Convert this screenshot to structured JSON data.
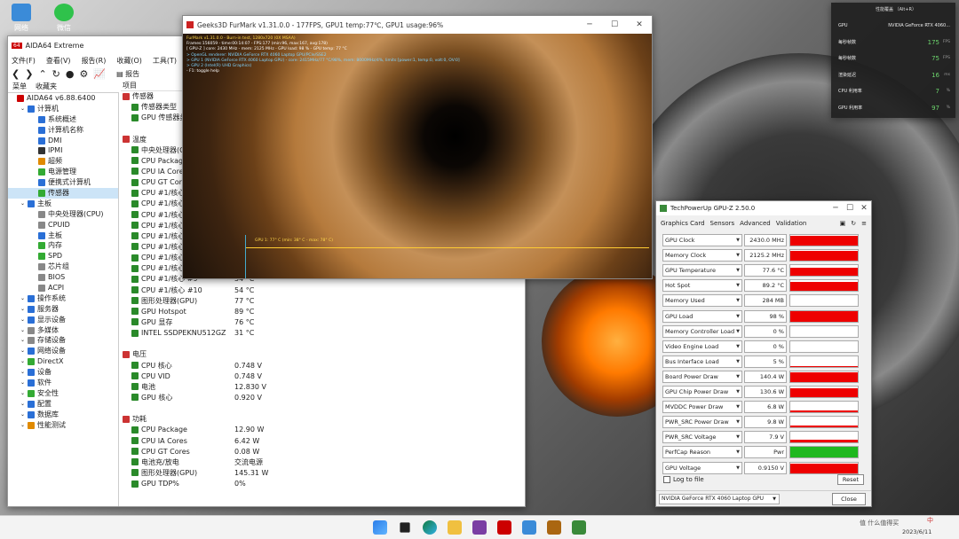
{
  "desktop": {
    "icons": [
      {
        "label": "网络"
      },
      {
        "label": "微信"
      }
    ]
  },
  "aida": {
    "title": "AIDA64 Extreme",
    "menu": [
      "文件(F)",
      "查看(V)",
      "报告(R)",
      "收藏(O)",
      "工具(T)",
      "帮助(H)"
    ],
    "toolbar_report": "报告",
    "tab_menu": "菜单",
    "tab_fav": "收藏夹",
    "tree": [
      {
        "label": "AIDA64 v6.88.6400",
        "depth": 0,
        "color": "#c00"
      },
      {
        "label": "计算机",
        "depth": 1,
        "color": "#2a6fd6"
      },
      {
        "label": "系统概述",
        "depth": 2,
        "color": "#2a6fd6"
      },
      {
        "label": "计算机名称",
        "depth": 2,
        "color": "#2a6fd6"
      },
      {
        "label": "DMI",
        "depth": 2,
        "color": "#2a6fd6"
      },
      {
        "label": "IPMI",
        "depth": 2,
        "color": "#333"
      },
      {
        "label": "超频",
        "depth": 2,
        "color": "#e08a00"
      },
      {
        "label": "电源管理",
        "depth": 2,
        "color": "#3a3"
      },
      {
        "label": "便携式计算机",
        "depth": 2,
        "color": "#2a6fd6"
      },
      {
        "label": "传感器",
        "depth": 2,
        "color": "#3a3",
        "selected": true
      },
      {
        "label": "主板",
        "depth": 1,
        "color": "#2a6fd6"
      },
      {
        "label": "中央处理器(CPU)",
        "depth": 2,
        "color": "#888"
      },
      {
        "label": "CPUID",
        "depth": 2,
        "color": "#888"
      },
      {
        "label": "主板",
        "depth": 2,
        "color": "#2a6fd6"
      },
      {
        "label": "内存",
        "depth": 2,
        "color": "#3a3"
      },
      {
        "label": "SPD",
        "depth": 2,
        "color": "#3a3"
      },
      {
        "label": "芯片组",
        "depth": 2,
        "color": "#888"
      },
      {
        "label": "BIOS",
        "depth": 2,
        "color": "#888"
      },
      {
        "label": "ACPI",
        "depth": 2,
        "color": "#888"
      },
      {
        "label": "操作系统",
        "depth": 1,
        "color": "#2a6fd6"
      },
      {
        "label": "服务器",
        "depth": 1,
        "color": "#2a6fd6"
      },
      {
        "label": "显示设备",
        "depth": 1,
        "color": "#2a6fd6"
      },
      {
        "label": "多媒体",
        "depth": 1,
        "color": "#888"
      },
      {
        "label": "存储设备",
        "depth": 1,
        "color": "#888"
      },
      {
        "label": "网络设备",
        "depth": 1,
        "color": "#2a6fd6"
      },
      {
        "label": "DirectX",
        "depth": 1,
        "color": "#3a3"
      },
      {
        "label": "设备",
        "depth": 1,
        "color": "#2a6fd6"
      },
      {
        "label": "软件",
        "depth": 1,
        "color": "#2a6fd6"
      },
      {
        "label": "安全性",
        "depth": 1,
        "color": "#3a3"
      },
      {
        "label": "配置",
        "depth": 1,
        "color": "#2a6fd6"
      },
      {
        "label": "数据库",
        "depth": 1,
        "color": "#2a6fd6"
      },
      {
        "label": "性能测试",
        "depth": 1,
        "color": "#e08a00"
      }
    ],
    "col_header": "项目",
    "rows": [
      {
        "label": "传感器",
        "value": "",
        "depth": 0,
        "section": true
      },
      {
        "label": "传感器类型",
        "value": "",
        "depth": 1
      },
      {
        "label": "GPU 传感器类型",
        "value": "",
        "depth": 1
      },
      {
        "label": "",
        "value": "",
        "depth": 0
      },
      {
        "label": "温度",
        "value": "",
        "depth": 0,
        "section": true
      },
      {
        "label": "中央处理器(CPU)",
        "value": "",
        "depth": 1
      },
      {
        "label": "CPU Package",
        "value": "",
        "depth": 1
      },
      {
        "label": "CPU IA Cores",
        "value": "",
        "depth": 1
      },
      {
        "label": "CPU GT Cores",
        "value": "",
        "depth": 1
      },
      {
        "label": "CPU #1/核心 #1",
        "value": "",
        "depth": 1
      },
      {
        "label": "CPU #1/核心 #2",
        "value": "",
        "depth": 1
      },
      {
        "label": "CPU #1/核心 #3",
        "value": "",
        "depth": 1
      },
      {
        "label": "CPU #1/核心 #4",
        "value": "",
        "depth": 1
      },
      {
        "label": "CPU #1/核心 #5",
        "value": "",
        "depth": 1
      },
      {
        "label": "CPU #1/核心 #6",
        "value": "",
        "depth": 1
      },
      {
        "label": "CPU #1/核心 #7",
        "value": "",
        "depth": 1
      },
      {
        "label": "CPU #1/核心 #8",
        "value": "",
        "depth": 1
      },
      {
        "label": "CPU #1/核心 #9",
        "value": "54 °C",
        "depth": 1
      },
      {
        "label": "CPU #1/核心 #10",
        "value": "54 °C",
        "depth": 1
      },
      {
        "label": "图形处理器(GPU)",
        "value": "77 °C",
        "depth": 1
      },
      {
        "label": "GPU Hotspot",
        "value": "89 °C",
        "depth": 1
      },
      {
        "label": "GPU 显存",
        "value": "76 °C",
        "depth": 1
      },
      {
        "label": "INTEL SSDPEKNU512GZ",
        "value": "31 °C",
        "depth": 1
      },
      {
        "label": "",
        "value": "",
        "depth": 0
      },
      {
        "label": "电压",
        "value": "",
        "depth": 0,
        "section": true
      },
      {
        "label": "CPU 核心",
        "value": "0.748 V",
        "depth": 1
      },
      {
        "label": "CPU VID",
        "value": "0.748 V",
        "depth": 1
      },
      {
        "label": "电池",
        "value": "12.830 V",
        "depth": 1
      },
      {
        "label": "GPU 核心",
        "value": "0.920 V",
        "depth": 1
      },
      {
        "label": "",
        "value": "",
        "depth": 0
      },
      {
        "label": "功耗",
        "value": "",
        "depth": 0,
        "section": true
      },
      {
        "label": "CPU Package",
        "value": "12.90 W",
        "depth": 1
      },
      {
        "label": "CPU IA Cores",
        "value": "6.42 W",
        "depth": 1
      },
      {
        "label": "CPU GT Cores",
        "value": "0.08 W",
        "depth": 1
      },
      {
        "label": "电池充/放电",
        "value": "交流电源",
        "depth": 1
      },
      {
        "label": "图形处理器(GPU)",
        "value": "145.31 W",
        "depth": 1
      },
      {
        "label": "GPU TDP%",
        "value": "0%",
        "depth": 1
      }
    ]
  },
  "furmark": {
    "title": "Geeks3D FurMark v1.31.0.0 - 177FPS, GPU1 temp:77℃, GPU1 usage:96%",
    "hud": [
      {
        "text": "FurMark v1.31.0.0 - Burn-in test, 1280x720 (0X MSAA)",
        "color": "#ffd84a"
      },
      {
        "text": "Frames:156059 - time:00:14:07 - FPS:177 (min:96, max:167, avg:178)",
        "color": "#fff"
      },
      {
        "text": "[ GPU-Z ] core: 2430 MHz - mem: 2125 MHz - GPU load: 98 % - GPU temp: 77 °C",
        "color": "#fff"
      },
      {
        "text": "> OpenGL renderer: NVIDIA GeForce RTX 4060 Laptop GPU/PCIe/SSE2",
        "color": "#7fd4ff"
      },
      {
        "text": "> GPU 1 (NVIDIA GeForce RTX 4060 Laptop GPU) - core: 2415MHz/77 °C/98%, mem: 8000MHz/4%, limits:[power:1, temp:0, volt:0, OV:0]",
        "color": "#7fd4ff"
      },
      {
        "text": "> GPU 2 (Intel(R) UHD Graphics)",
        "color": "#7fd4ff"
      },
      {
        "text": "- F1: toggle help",
        "color": "#fff"
      }
    ],
    "graph_label": "GPU 1: 77° C (min: 38° C - max: 78° C)"
  },
  "gpuz": {
    "title": "TechPowerUp GPU-Z 2.50.0",
    "tabs": [
      "Graphics Card",
      "Sensors",
      "Advanced",
      "Validation"
    ],
    "sensors": [
      {
        "label": "GPU Clock",
        "value": "2430.0 MHz",
        "level": 0.95,
        "color": "#e00"
      },
      {
        "label": "Memory Clock",
        "value": "2125.2 MHz",
        "level": 0.9,
        "color": "#e00"
      },
      {
        "label": "GPU Temperature",
        "value": "77.6 °C",
        "level": 0.75,
        "color": "#e00"
      },
      {
        "label": "Hot Spot",
        "value": "89.2 °C",
        "level": 0.85,
        "color": "#e00"
      },
      {
        "label": "Memory Used",
        "value": "284 MB",
        "level": 0.05,
        "color": "#e00"
      },
      {
        "label": "GPU Load",
        "value": "98 %",
        "level": 0.98,
        "color": "#e00"
      },
      {
        "label": "Memory Controller Load",
        "value": "0 %",
        "level": 0,
        "color": "#e00"
      },
      {
        "label": "Video Engine Load",
        "value": "0 %",
        "level": 0,
        "color": "#e00"
      },
      {
        "label": "Bus Interface Load",
        "value": "5 %",
        "level": 0.05,
        "color": "#e00"
      },
      {
        "label": "Board Power Draw",
        "value": "140.4 W",
        "level": 0.9,
        "color": "#e00"
      },
      {
        "label": "GPU Chip Power Draw",
        "value": "130.6 W",
        "level": 0.85,
        "color": "#e00"
      },
      {
        "label": "MVDDC Power Draw",
        "value": "6.8 W",
        "level": 0.15,
        "color": "#e00"
      },
      {
        "label": "PWR_SRC Power Draw",
        "value": "9.8 W",
        "level": 0.2,
        "color": "#e00"
      },
      {
        "label": "PWR_SRC Voltage",
        "value": "7.9 V",
        "level": 0.3,
        "color": "#e00"
      },
      {
        "label": "PerfCap Reason",
        "value": "Pwr",
        "level": 1,
        "color": "#1fb81f"
      },
      {
        "label": "GPU Voltage",
        "value": "0.9150 V",
        "level": 0.85,
        "color": "#e00"
      }
    ],
    "log_label": "Log to file",
    "reset": "Reset",
    "device": "NVIDIA GeForce RTX 4060 Laptop GPU",
    "close": "Close"
  },
  "overlay": {
    "title": "性能覆盖 （Alt+R）",
    "rows": [
      {
        "label": "GPU",
        "value": "NVIDIA GeForce RTX 4060...",
        "unit": ""
      },
      {
        "label": "每秒帧数",
        "value": "175",
        "unit": "FPS"
      },
      {
        "label": "每秒帧数",
        "value": "75",
        "unit": "FPS"
      },
      {
        "label": "渲染延迟",
        "value": "16",
        "unit": "ms"
      },
      {
        "label": "CPU 利用率",
        "value": "7",
        "unit": "%"
      },
      {
        "label": "GPU 利用率",
        "value": "97",
        "unit": "%"
      }
    ]
  },
  "taskbar": {
    "time": "",
    "date": "2023/6/11",
    "ime": "中",
    "watermark": "值 什么值得买"
  }
}
